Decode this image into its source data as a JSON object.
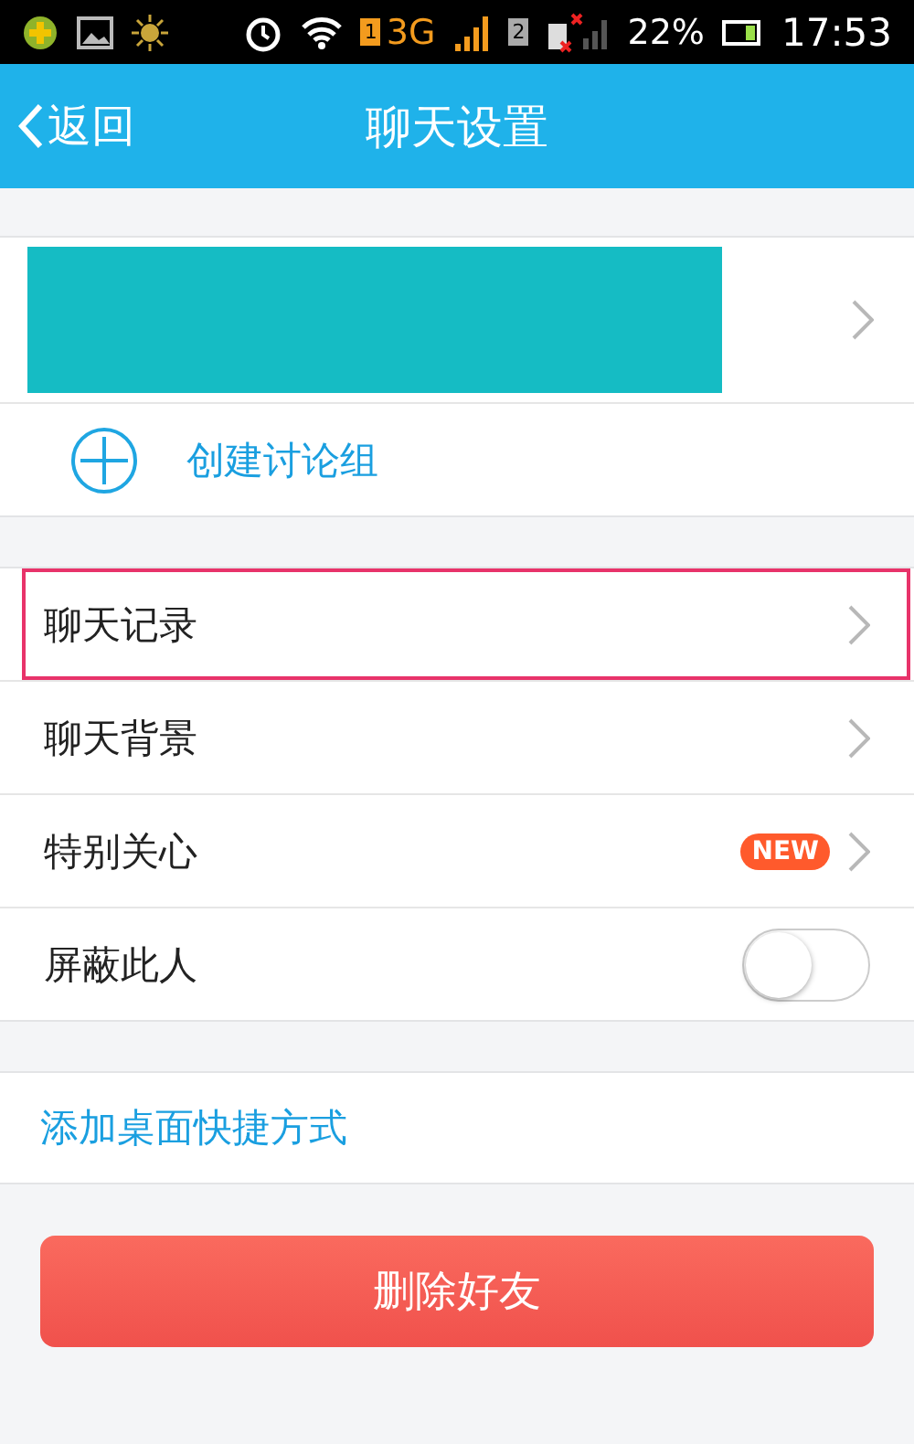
{
  "status_bar": {
    "sim1": "1",
    "network": "3G",
    "sim2": "2",
    "battery": "22%",
    "time": "17:53"
  },
  "header": {
    "back": "返回",
    "title": "聊天设置"
  },
  "profile": {
    "redacted": true
  },
  "create_group": {
    "label": "创建讨论组"
  },
  "settings": [
    {
      "kind": "link",
      "label": "聊天记录",
      "highlighted": true
    },
    {
      "kind": "link",
      "label": "聊天背景",
      "highlighted": false
    },
    {
      "kind": "badge",
      "label": "特别关心",
      "badge": "NEW",
      "highlighted": false
    },
    {
      "kind": "toggle",
      "label": "屏蔽此人",
      "on": false,
      "highlighted": false
    }
  ],
  "shortcut": {
    "label": "添加桌面快捷方式"
  },
  "delete_button": "删除好友"
}
